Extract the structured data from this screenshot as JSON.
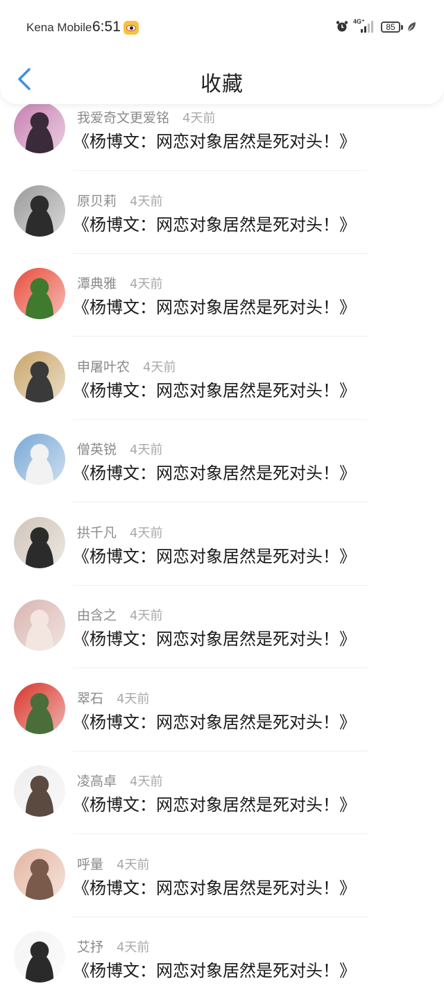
{
  "status_bar": {
    "carrier": "Kena Mobile",
    "time": "6:51",
    "network": "4G⁺",
    "battery": "85"
  },
  "nav": {
    "title": "收藏",
    "accent_color": "#3d8fe0"
  },
  "items": [
    {
      "author": "我爱奇文更爱铭",
      "time": "4天前",
      "title": "《杨博文：网恋对象居然是死对头！》"
    },
    {
      "author": "原贝莉",
      "time": "4天前",
      "title": "《杨博文：网恋对象居然是死对头！》"
    },
    {
      "author": "潭典雅",
      "time": "4天前",
      "title": "《杨博文：网恋对象居然是死对头！》"
    },
    {
      "author": "申屠叶农",
      "time": "4天前",
      "title": "《杨博文：网恋对象居然是死对头！》"
    },
    {
      "author": "僧英锐",
      "time": "4天前",
      "title": "《杨博文：网恋对象居然是死对头！》"
    },
    {
      "author": "拱千凡",
      "time": "4天前",
      "title": "《杨博文：网恋对象居然是死对头！》"
    },
    {
      "author": "由含之",
      "time": "4天前",
      "title": "《杨博文：网恋对象居然是死对头！》"
    },
    {
      "author": "翠石",
      "time": "4天前",
      "title": "《杨博文：网恋对象居然是死对头！》"
    },
    {
      "author": "凌高卓",
      "time": "4天前",
      "title": "《杨博文：网恋对象居然是死对头！》"
    },
    {
      "author": "呼量",
      "time": "4天前",
      "title": "《杨博文：网恋对象居然是死对头！》"
    },
    {
      "author": "艾抒",
      "time": "4天前",
      "title": "《杨博文：网恋对象居然是死对头！》"
    }
  ],
  "avatar_colors": [
    [
      "#c77fb0",
      "#3a2a3a"
    ],
    [
      "#9a9a9a",
      "#2c2c2c"
    ],
    [
      "#e84d3c",
      "#3f7a2e"
    ],
    [
      "#c9a66b",
      "#3a3a3a"
    ],
    [
      "#7aa9d6",
      "#f2f2f2"
    ],
    [
      "#cfc4b8",
      "#2b2b2b"
    ],
    [
      "#d8b5b0",
      "#f3e6e0"
    ],
    [
      "#d8352a",
      "#4a6e3a"
    ],
    [
      "#eeeeee",
      "#5a4a40"
    ],
    [
      "#e4b5a2",
      "#7a5a4a"
    ],
    [
      "#f4f4f4",
      "#2a2a2a"
    ]
  ]
}
